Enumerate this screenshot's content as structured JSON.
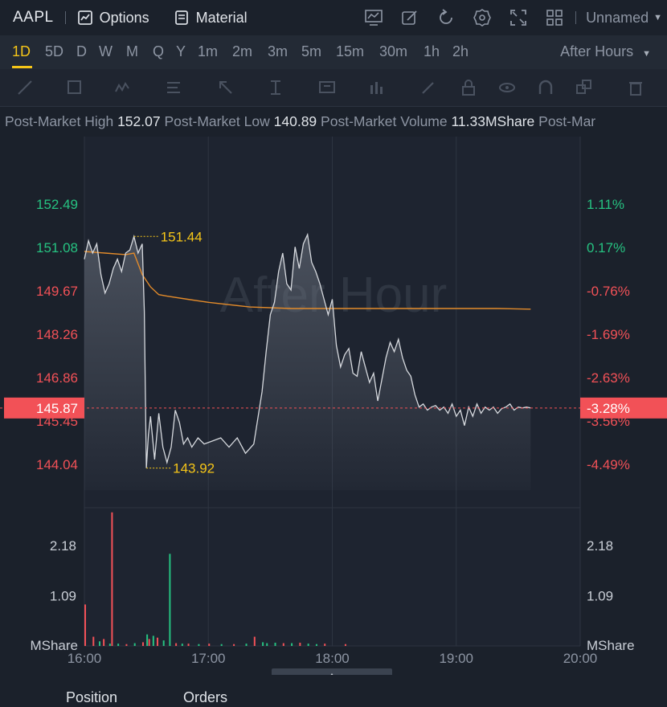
{
  "header": {
    "symbol": "AAPL",
    "options_label": "Options",
    "material_label": "Material",
    "layout_name": "Unnamed",
    "icons": [
      "indicator-icon",
      "edit-icon",
      "refresh-icon",
      "settings-icon",
      "fullscreen-icon",
      "layout-grid-icon"
    ]
  },
  "periods": {
    "items": [
      "1D",
      "5D",
      "D",
      "W",
      "M",
      "Q",
      "Y",
      "1m",
      "2m",
      "3m",
      "5m",
      "15m",
      "30m",
      "1h",
      "2h"
    ],
    "selected": "1D",
    "session_label": "After Hours"
  },
  "drawing_tools": [
    "line-tool-icon",
    "rectangle-tool-icon",
    "pattern-tool-icon",
    "fibonacci-tool-icon",
    "arrow-tool-icon",
    "measure-tool-icon",
    "text-tool-icon",
    "volume-profile-icon",
    "pen-tool-icon",
    "lock-icon",
    "eye-icon",
    "magnet-icon",
    "layers-icon",
    "trash-icon"
  ],
  "info": [
    {
      "label": "Post-Market High",
      "value": "152.07"
    },
    {
      "label": "Post-Market Low",
      "value": "140.89"
    },
    {
      "label": "Post-Market Volume",
      "value": "11.33MShare"
    },
    {
      "label": "Post-Mar",
      "value": ""
    }
  ],
  "colors": {
    "up": "#26c281",
    "down": "#f25157",
    "avg_line": "#e38b2a",
    "price_line": "#d6d9de",
    "label_high_low": "#f5c518",
    "watermark": "#2f3642"
  },
  "chart_data": {
    "type": "line",
    "watermark": "After Hour",
    "x_ticks": [
      "16:00",
      "17:00",
      "18:00",
      "19:00",
      "20:00"
    ],
    "x_range_minutes": [
      0,
      240
    ],
    "price_ticks": [
      "152.49",
      "151.08",
      "149.67",
      "148.26",
      "146.86",
      "145.45",
      "144.04"
    ],
    "price_tick_values": [
      152.49,
      151.08,
      149.67,
      148.26,
      146.86,
      145.45,
      144.04
    ],
    "price_tick_colors": [
      "up",
      "up",
      "down",
      "down",
      "down",
      "down",
      "down"
    ],
    "pct_ticks": [
      "1.11%",
      "0.17%",
      "-0.76%",
      "-1.69%",
      "-2.63%",
      "-3.56%",
      "-4.49%"
    ],
    "ylim": [
      143.5,
      153.5
    ],
    "current_price": "145.87",
    "current_pct": "-3.28%",
    "current_value": 145.87,
    "high_label": "151.44",
    "high_point": {
      "minute": 24,
      "price": 151.44
    },
    "low_label": "143.92",
    "low_point": {
      "minute": 30,
      "price": 143.92
    },
    "series": [
      {
        "kind": "price",
        "x": [
          0,
          2,
          4,
          6,
          8,
          10,
          12,
          14,
          16,
          18,
          20,
          22,
          24,
          26,
          28,
          29,
          30,
          31,
          32,
          34,
          36,
          38,
          40,
          42,
          44,
          46,
          48,
          50,
          52,
          55,
          58,
          62,
          66,
          70,
          74,
          78,
          82,
          86,
          88,
          90,
          92,
          94,
          96,
          98,
          100,
          102,
          104,
          106,
          108,
          110,
          112,
          114,
          116,
          118,
          120,
          122,
          124,
          126,
          128,
          130,
          132,
          134,
          136,
          138,
          140,
          142,
          144,
          146,
          148,
          150,
          152,
          154,
          156,
          158,
          160,
          162,
          164,
          166,
          168,
          170,
          172,
          174,
          176,
          178,
          180,
          182,
          184,
          186,
          188,
          190,
          192,
          194,
          196,
          198,
          200,
          202,
          204,
          206,
          208,
          210,
          212,
          214,
          216
        ],
        "y": [
          150.7,
          151.3,
          150.9,
          151.2,
          150.2,
          149.6,
          149.9,
          150.4,
          150.7,
          150.3,
          150.9,
          151.0,
          151.44,
          150.9,
          151.2,
          149.0,
          143.92,
          145.0,
          145.6,
          144.2,
          145.7,
          144.6,
          144.1,
          144.6,
          145.8,
          145.4,
          144.7,
          144.9,
          144.6,
          144.9,
          144.7,
          144.8,
          144.9,
          144.6,
          144.9,
          144.4,
          144.7,
          146.4,
          147.7,
          148.9,
          149.3,
          150.3,
          150.9,
          149.9,
          149.7,
          151.1,
          150.4,
          151.2,
          151.5,
          150.6,
          150.3,
          149.9,
          149.4,
          148.9,
          149.4,
          147.9,
          147.2,
          147.6,
          147.8,
          147.0,
          146.9,
          147.7,
          147.2,
          146.7,
          147.0,
          146.1,
          146.8,
          147.5,
          148.0,
          147.7,
          148.1,
          147.5,
          147.1,
          146.9,
          146.3,
          145.9,
          146.0,
          145.8,
          145.9,
          145.95,
          145.8,
          145.9,
          145.7,
          146.0,
          145.6,
          145.8,
          145.3,
          145.9,
          145.6,
          146.0,
          145.7,
          145.9,
          145.8,
          145.9,
          145.7,
          145.85,
          145.9,
          146.0,
          145.8,
          145.9,
          145.87,
          145.9,
          145.87
        ]
      },
      {
        "kind": "average",
        "x": [
          0,
          10,
          20,
          24,
          28,
          32,
          36,
          40,
          50,
          60,
          80,
          100,
          120,
          140,
          160,
          180,
          200,
          216
        ],
        "y": [
          150.95,
          150.9,
          150.85,
          150.9,
          150.2,
          149.8,
          149.55,
          149.5,
          149.4,
          149.3,
          149.15,
          149.1,
          149.1,
          149.1,
          149.1,
          149.1,
          149.1,
          149.08
        ]
      }
    ],
    "volume": {
      "ylabel": "MShare",
      "ticks": [
        "2.18",
        "1.09"
      ],
      "tick_values": [
        2.18,
        1.09
      ],
      "ylim": [
        0,
        3.0
      ],
      "bars": [
        {
          "minute": 0,
          "value": 0.9,
          "up": false
        },
        {
          "minute": 4,
          "value": 0.2,
          "up": false
        },
        {
          "minute": 7,
          "value": 0.1,
          "up": true
        },
        {
          "minute": 9,
          "value": 0.15,
          "up": false
        },
        {
          "minute": 12,
          "value": 0.05,
          "up": true
        },
        {
          "minute": 13,
          "value": 2.9,
          "up": false
        },
        {
          "minute": 16,
          "value": 0.05,
          "up": true
        },
        {
          "minute": 20,
          "value": 0.04,
          "up": false
        },
        {
          "minute": 24,
          "value": 0.06,
          "up": true
        },
        {
          "minute": 28,
          "value": 0.08,
          "up": false
        },
        {
          "minute": 30,
          "value": 0.25,
          "up": true
        },
        {
          "minute": 31,
          "value": 0.15,
          "up": false
        },
        {
          "minute": 33,
          "value": 0.22,
          "up": true
        },
        {
          "minute": 35,
          "value": 0.18,
          "up": false
        },
        {
          "minute": 38,
          "value": 0.12,
          "up": true
        },
        {
          "minute": 41,
          "value": 2.0,
          "up": true
        },
        {
          "minute": 44,
          "value": 0.06,
          "up": false
        },
        {
          "minute": 47,
          "value": 0.05,
          "up": true
        },
        {
          "minute": 50,
          "value": 0.05,
          "up": false
        },
        {
          "minute": 55,
          "value": 0.04,
          "up": true
        },
        {
          "minute": 60,
          "value": 0.05,
          "up": false
        },
        {
          "minute": 66,
          "value": 0.04,
          "up": true
        },
        {
          "minute": 72,
          "value": 0.04,
          "up": false
        },
        {
          "minute": 78,
          "value": 0.05,
          "up": true
        },
        {
          "minute": 82,
          "value": 0.2,
          "up": false
        },
        {
          "minute": 86,
          "value": 0.08,
          "up": true
        },
        {
          "minute": 88,
          "value": 0.06,
          "up": true
        },
        {
          "minute": 92,
          "value": 0.07,
          "up": true
        },
        {
          "minute": 96,
          "value": 0.06,
          "up": false
        },
        {
          "minute": 100,
          "value": 0.06,
          "up": true
        },
        {
          "minute": 104,
          "value": 0.07,
          "up": false
        },
        {
          "minute": 108,
          "value": 0.05,
          "up": true
        },
        {
          "minute": 112,
          "value": 0.04,
          "up": true
        },
        {
          "minute": 116,
          "value": 0.05,
          "up": false
        },
        {
          "minute": 126,
          "value": 0.04,
          "up": false
        }
      ]
    }
  },
  "bottom": {
    "tabs_partial": [
      "Position",
      "Orders"
    ]
  }
}
